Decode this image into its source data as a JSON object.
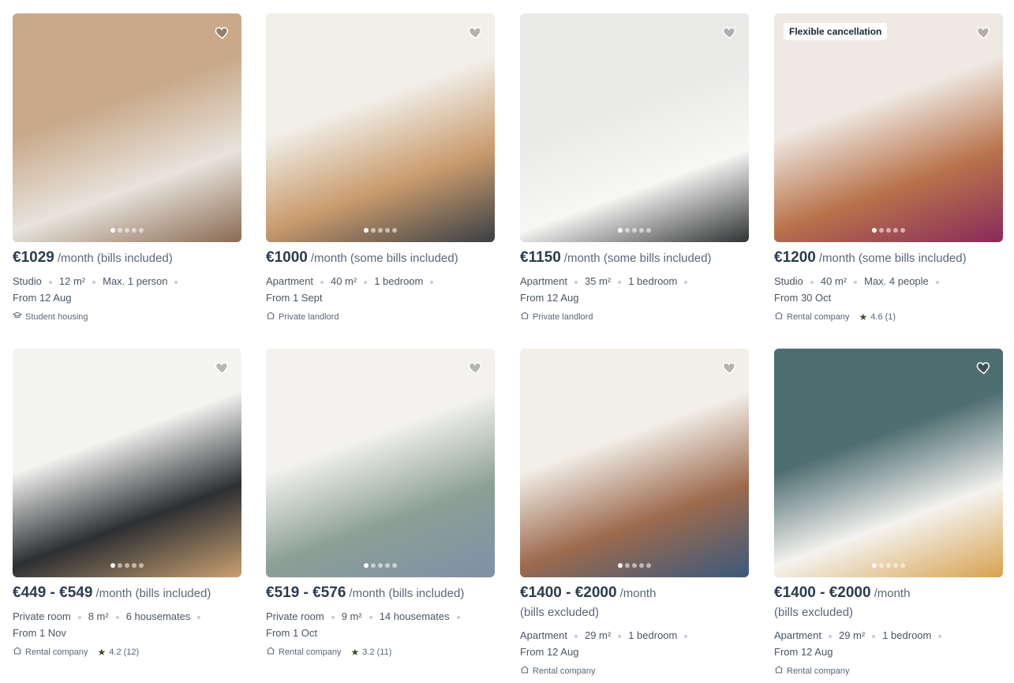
{
  "cards": [
    {
      "price": "€1029",
      "period": "/month (bills included)",
      "type": "Studio",
      "size": "12 m²",
      "extra": "Max. 1 person",
      "from": "From 12 Aug",
      "landlord": "Student housing",
      "landlord_icon": "graduation-cap-icon",
      "rating": "",
      "badge": "",
      "photo": [
        "#c9a98a",
        "#e8e3dc",
        "#8a6a52"
      ]
    },
    {
      "price": "€1000",
      "period": "/month (some bills included)",
      "type": "Apartment",
      "size": "40 m²",
      "extra": "1 bedroom",
      "from": "From 1 Sept",
      "landlord": "Private landlord",
      "landlord_icon": "home-icon",
      "rating": "",
      "badge": "",
      "photo": [
        "#f1efe9",
        "#c99b6d",
        "#3a3f45"
      ]
    },
    {
      "price": "€1150",
      "period": "/month (some bills included)",
      "type": "Apartment",
      "size": "35 m²",
      "extra": "1 bedroom",
      "from": "From 12 Aug",
      "landlord": "Private landlord",
      "landlord_icon": "home-icon",
      "rating": "",
      "badge": "",
      "photo": [
        "#e9eae8",
        "#f7f7f5",
        "#2f3133"
      ]
    },
    {
      "price": "€1200",
      "period": "/month (some bills included)",
      "type": "Studio",
      "size": "40 m²",
      "extra": "Max. 4 people",
      "from": "From 30 Oct",
      "landlord": "Rental company",
      "landlord_icon": "home-icon",
      "rating": "4.6 (1)",
      "badge": "Flexible cancellation",
      "photo": [
        "#efe9e3",
        "#b8734b",
        "#8a2a5c"
      ]
    },
    {
      "price": "€449 - €549",
      "period": "/month (bills included)",
      "type": "Private room",
      "size": "8 m²",
      "extra": "6 housemates",
      "from": "From 1 Nov",
      "landlord": "Rental company",
      "landlord_icon": "home-icon",
      "rating": "4.2 (12)",
      "badge": "",
      "photo": [
        "#f4f4f2",
        "#2c2f33",
        "#c9a070"
      ]
    },
    {
      "price": "€519 - €576",
      "period": "/month (bills included)",
      "type": "Private room",
      "size": "9 m²",
      "extra": "14 housemates",
      "from": "From 1 Oct",
      "landlord": "Rental company",
      "landlord_icon": "home-icon",
      "rating": "3.2 (11)",
      "badge": "",
      "photo": [
        "#f3f2ee",
        "#8ca095",
        "#7e90a8"
      ]
    },
    {
      "price": "€1400 - €2000",
      "period": "/month",
      "period2": "(bills excluded)",
      "type": "Apartment",
      "size": "29 m²",
      "extra": "1 bedroom",
      "from": "From 12 Aug",
      "landlord": "Rental company",
      "landlord_icon": "home-icon",
      "rating": "",
      "badge": "",
      "photo": [
        "#f2efe9",
        "#9d6a4e",
        "#3a5a7c"
      ]
    },
    {
      "price": "€1400 - €2000",
      "period": "/month",
      "period2": "(bills excluded)",
      "type": "Apartment",
      "size": "29 m²",
      "extra": "1 bedroom",
      "from": "From 12 Aug",
      "landlord": "Rental company",
      "landlord_icon": "home-icon",
      "rating": "",
      "badge": "",
      "photo": [
        "#4f6e72",
        "#f4f3ef",
        "#d7a24f"
      ]
    }
  ],
  "colors": {
    "accent": "#2d3b4e",
    "star": "#3b4a2a"
  }
}
